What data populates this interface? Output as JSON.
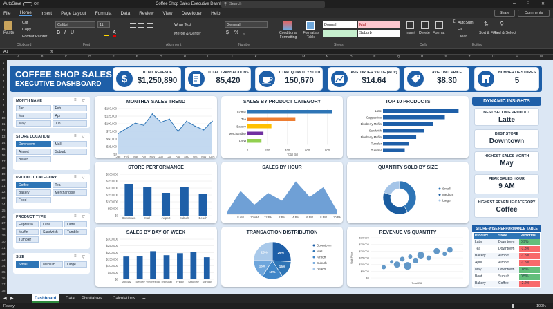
{
  "titlebar": {
    "autosave": "AutoSave",
    "toggle": "Off",
    "filename": "Coffee Shop Sales Executive Dashboard",
    "search": "Search"
  },
  "ribbon": {
    "tabs": [
      "File",
      "Home",
      "Insert",
      "Page Layout",
      "Formula",
      "Data",
      "Review",
      "View",
      "Developer",
      "Help"
    ],
    "share": "Share",
    "comments": "Comments",
    "paste": "Paste",
    "cut": "Cut",
    "copy": "Copy",
    "format_painter": "Format Painter",
    "font_name": "Calibri",
    "font_size": "11",
    "wrap_text": "Wrap Text",
    "merge_center": "Merge & Center",
    "number_format": "General",
    "conditional_formatting": "Conditional Formatting",
    "format_as_table": "Format as Table",
    "style_cells": [
      "Donnal",
      "Mal",
      "Suburb"
    ],
    "insert": "Insert",
    "delete": "Delete",
    "format": "Format",
    "autosum": "AutoSum",
    "fill": "Fill",
    "clear": "Clear",
    "sort_filter": "Sort & Filter",
    "find_select": "Find & Select",
    "groups": [
      "Clipboard",
      "Font",
      "Alignment",
      "Number",
      "Styles",
      "Cells",
      "Editing"
    ]
  },
  "formula_bar": {
    "cell_ref": "A1",
    "fx": "fx"
  },
  "columns": [
    "A",
    "B",
    "C",
    "D",
    "E",
    "F",
    "G",
    "H",
    "I",
    "J",
    "K",
    "L",
    "M",
    "N",
    "O",
    "P",
    "Q",
    "R",
    "S",
    "T",
    "U",
    "V",
    "W"
  ],
  "rows": [
    "1",
    "2",
    "3",
    "4",
    "5",
    "6",
    "7",
    "8",
    "9",
    "10",
    "11",
    "12",
    "13",
    "14",
    "15",
    "16",
    "17",
    "18",
    "19",
    "20",
    "21",
    "22",
    "23",
    "24",
    "25",
    "26",
    "27",
    "28",
    "29",
    "30",
    "31",
    "32",
    "33",
    "34",
    "35",
    "36",
    "37",
    "38"
  ],
  "header": {
    "title_line1": "COFFEE SHOP SALES",
    "title_line2": "EXECUTIVE DASHBOARD"
  },
  "kpis": [
    {
      "label": "TOTAL REVENUE",
      "value": "$1,250,890",
      "icon": "dollar-icon"
    },
    {
      "label": "TOTAL TRANSACTIONS",
      "value": "85,420",
      "icon": "receipt-icon"
    },
    {
      "label": "TOTAL QUANTITY SOLD",
      "value": "150,670",
      "icon": "coffee-cup-icon"
    },
    {
      "label": "AVG. ORDER VALUE (AOV)",
      "value": "$14.64",
      "icon": "trend-icon"
    },
    {
      "label": "AVG. UNIT PRICE",
      "value": "$8.30",
      "icon": "price-tag-icon"
    },
    {
      "label": "NUMBER OF STORES",
      "value": "5",
      "icon": "store-icon"
    }
  ],
  "slicers": {
    "month": {
      "title": "MONTH NAME",
      "items": [
        "Jan",
        "Feb",
        "Mar",
        "Apr",
        "May",
        "Jun"
      ],
      "selected": [
        false,
        false,
        false,
        false,
        false,
        false
      ]
    },
    "store": {
      "title": "STORE LOCATION",
      "items": [
        "Downtown",
        "Mall",
        "Airport",
        "Suburb",
        "Beach"
      ],
      "selected": [
        true,
        false,
        false,
        false,
        false
      ]
    },
    "category": {
      "title": "PRODUCT CATEGORY",
      "items": [
        "Coffee",
        "Tea",
        "Bakery",
        "Merchandise",
        "Food"
      ],
      "selected": [
        true,
        false,
        false,
        false,
        false
      ]
    },
    "ptype": {
      "title": "PRODUCT TYPE",
      "items": [
        "Espresso",
        "Latte",
        "Latte",
        "Muffin",
        "Sandwich",
        "Tumbler",
        "Tumbler"
      ],
      "selected": [
        false,
        false,
        false,
        false,
        false,
        false,
        false
      ]
    },
    "size": {
      "title": "SIZE",
      "items": [
        "Small",
        "Medium",
        "Large"
      ],
      "selected": [
        true,
        false,
        false
      ]
    }
  },
  "charts": {
    "monthly": {
      "title": "MONTHLY SALES TREND"
    },
    "category": {
      "title": "SALES BY PRODUCT CATEGORY"
    },
    "top10": {
      "title": "TOP 10 PRODUCTS"
    },
    "store": {
      "title": "STORE PERFORMANCE"
    },
    "hour": {
      "title": "SALES BY HOUR"
    },
    "size": {
      "title": "QUANTITY SOLD BY SIZE"
    },
    "dow": {
      "title": "SALES BY DAY OF WEEK"
    },
    "trans": {
      "title": "TRANSACTION DISTRIBUTION"
    },
    "revqty": {
      "title": "REVENUE VS QUANTITY"
    }
  },
  "chart_data": [
    {
      "id": "monthly",
      "type": "area",
      "title": "MONTHLY SALES TREND",
      "categories": [
        "Jan",
        "Feb",
        "Mar",
        "Apr",
        "May",
        "Jun",
        "Jul",
        "Aug",
        "Sep",
        "Oct",
        "Nov",
        "Dec"
      ],
      "values": [
        68000,
        85000,
        102000,
        95000,
        132000,
        105000,
        115000,
        75000,
        108000,
        92000,
        80000,
        108000
      ],
      "yticks": [
        "$150,000",
        "$125,000",
        "$100,000",
        "$75,000",
        "$50,000",
        "$25,000",
        "$0"
      ],
      "ylim": [
        0,
        150000
      ]
    },
    {
      "id": "category",
      "type": "bar",
      "title": "SALES BY PRODUCT CATEGORY",
      "xlabel": "Total Bill",
      "categories": [
        "Coffee",
        "Tea",
        "Bakery",
        "Merchandise",
        "Food"
      ],
      "values": [
        850,
        480,
        240,
        160,
        140
      ],
      "xticks": [
        "0",
        "200",
        "400",
        "600",
        "800"
      ],
      "xlim": [
        0,
        900
      ],
      "colors": [
        "#2e75b6",
        "#ed7d31",
        "#ffc000",
        "#7030a0",
        "#92d050"
      ]
    },
    {
      "id": "top10",
      "type": "bar",
      "title": "TOP 10 PRODUCTS",
      "categories": [
        "Latte",
        "Cappuccino",
        "Blueberry Muffin",
        "Sandwich",
        "Blueberry Muffin",
        "Tumbler",
        "Tumbler"
      ],
      "values": [
        132,
        108,
        88,
        72,
        58,
        45,
        38
      ],
      "xlim": [
        0,
        140
      ]
    },
    {
      "id": "store",
      "type": "bar",
      "title": "STORE PERFORMANCE",
      "categories": [
        "Downtown",
        "Mall",
        "Airport",
        "Suburb",
        "Beach"
      ],
      "values": [
        230000,
        205000,
        165000,
        210000,
        160000
      ],
      "yticks": [
        "$300,000",
        "$250,000",
        "$200,000",
        "$150,000",
        "$100,000",
        "$50,000",
        "$0"
      ],
      "ylim": [
        0,
        300000
      ]
    },
    {
      "id": "hour",
      "type": "area",
      "title": "SALES BY HOUR",
      "categories": [
        "6 AM",
        "8 AM",
        "10 AM",
        "12 PM",
        "2 PM",
        "4 PM",
        "6 PM",
        "8 PM",
        "10 PM"
      ],
      "values": [
        5,
        60,
        25,
        55,
        35,
        85,
        45,
        70,
        8
      ],
      "xticks": [
        "8 AM",
        "10 AM",
        "12 PM",
        "2 PM",
        "4 PM",
        "6 PM",
        "8 PM",
        "10 PM"
      ]
    },
    {
      "id": "size",
      "type": "pie",
      "title": "QUANTITY SOLD BY SIZE",
      "donut": true,
      "categories": [
        "Small",
        "Medium",
        "Large"
      ],
      "values": [
        42,
        38,
        20
      ],
      "colors": [
        "#2e75b6",
        "#1a5ca0",
        "#a5c5e8"
      ]
    },
    {
      "id": "dow",
      "type": "bar",
      "title": "SALES BY DAY OF WEEK",
      "categories": [
        "Monday",
        "Tuesday",
        "Wednesday",
        "Thursday",
        "Friday",
        "Saturday",
        "Sunday"
      ],
      "values": [
        170000,
        175000,
        210000,
        180000,
        195000,
        205000,
        165000
      ],
      "yticks": [
        "$300,000",
        "$250,000",
        "$200,000",
        "$150,000",
        "$100,000",
        "$50,000",
        "$0"
      ],
      "ylim": [
        0,
        300000
      ]
    },
    {
      "id": "trans",
      "type": "pie",
      "title": "TRANSACTION DISTRIBUTION",
      "categories": [
        "Downtown",
        "Mall",
        "Airport",
        "Suburb",
        "Beach"
      ],
      "values": [
        26,
        15,
        18,
        16,
        25
      ],
      "labels": [
        "26%",
        "15%",
        "18%",
        "16%",
        "25%"
      ],
      "colors": [
        "#1e5fa8",
        "#2e75b6",
        "#3f86c8",
        "#6ea6dc",
        "#a9c9ea"
      ]
    },
    {
      "id": "revqty",
      "type": "scatter",
      "title": "REVENUE VS QUANTITY",
      "xlabel": "Total Bill",
      "ylabel": "Unit Price",
      "yticks": [
        "$30,000",
        "$25,000",
        "$20,000",
        "$15,000",
        "$10,000",
        "$5,000",
        "$0"
      ],
      "x": [
        5,
        8,
        10,
        12,
        14,
        15,
        17,
        19,
        22,
        25,
        28,
        30
      ],
      "y": [
        8,
        12,
        10,
        14,
        9,
        16,
        13,
        17,
        15,
        20,
        18,
        21
      ],
      "size": [
        6,
        5,
        9,
        7,
        11,
        6,
        8,
        10,
        7,
        9,
        6,
        8
      ],
      "xlim": [
        0,
        35
      ],
      "ylim": [
        0,
        30
      ]
    }
  ],
  "insights": {
    "title": "DYNAMIC INSIGHTS",
    "items": [
      {
        "label": "BEST SELLING PRODUCT",
        "value": "Latte"
      },
      {
        "label": "BEST STORE",
        "value": "Downtown"
      },
      {
        "label": "HIGHEST SALES MONTH",
        "value": "May"
      },
      {
        "label": "PEAK SALES HOUR",
        "value": "9 AM"
      },
      {
        "label": "HIGHEST REVENUE CATEGORY",
        "value": "Coffee"
      }
    ]
  },
  "perf_table": {
    "title": "STORE-WISE PERFORMANCE TABLE",
    "headers": [
      "Product",
      "Store",
      "Performs"
    ],
    "rows": [
      [
        "Latte",
        "Downtown",
        "0.9%"
      ],
      [
        "Tea",
        "Downtown",
        "-1.3%"
      ],
      [
        "Bakery",
        "Airport",
        "-1.5%"
      ],
      [
        "April",
        "Airport",
        "-1.5%"
      ],
      [
        "May",
        "Downtown",
        "0.8%"
      ],
      [
        "Boot",
        "Suburb",
        "0.5%"
      ],
      [
        "Bakery",
        "Coffee",
        "-2.2%"
      ]
    ],
    "positive": [
      true,
      false,
      false,
      false,
      true,
      true,
      false
    ],
    "pos_color": "#63be7b",
    "neg_color": "#f8696b"
  },
  "sheet_tabs": [
    "Dashboard",
    "Data",
    "Pivottables",
    "Calculations"
  ],
  "status": {
    "ready": "Ready",
    "zoom": "100%"
  },
  "colors": {
    "header_blue": "#1e5fa8",
    "dashboard_bg": "#dce7f4",
    "accent": "#2e75b6"
  }
}
